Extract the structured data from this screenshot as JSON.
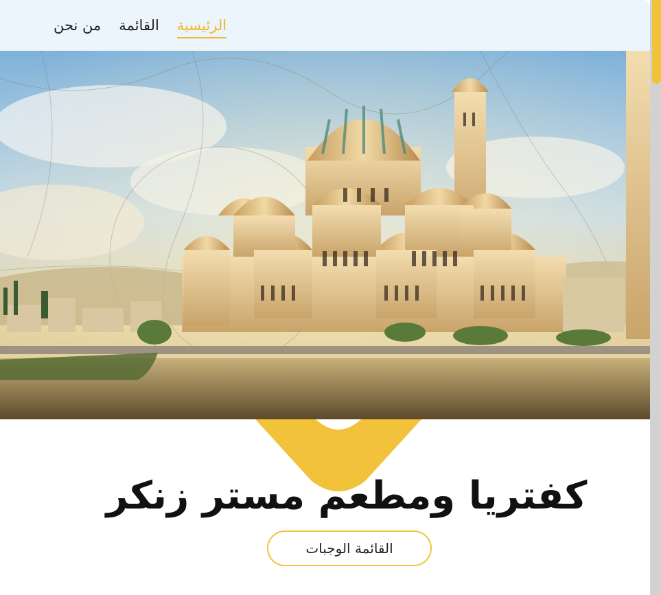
{
  "nav": {
    "items": [
      {
        "label": "من نحن",
        "active": false
      },
      {
        "label": "القائمة",
        "active": false
      },
      {
        "label": "الرئيسية",
        "active": true
      }
    ]
  },
  "hero": {
    "image_icon": "mosque-hero-image"
  },
  "main": {
    "title": "كفتريا ومطعم مستر زنكر",
    "cta_label": "القائمة الوجبات"
  },
  "colors": {
    "accent": "#f2c23a",
    "navbar_bg": "#ecf4fc",
    "active_link": "#f2b82a"
  }
}
